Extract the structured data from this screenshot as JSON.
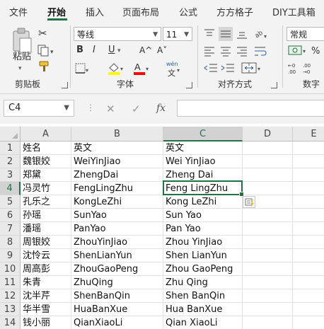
{
  "tabs": [
    "文件",
    "开始",
    "插入",
    "页面布局",
    "公式",
    "方方格子",
    "DIY工具箱"
  ],
  "ribbon": {
    "clipboard": {
      "paste_label": "粘贴",
      "group_label": "剪贴板"
    },
    "font": {
      "name": "等线",
      "size": "11",
      "bold": "B",
      "italic": "I",
      "underline": "U",
      "grow": "A^",
      "shrink": "A˅",
      "group_label": "字体",
      "wen": "wén",
      "wen2": "文"
    },
    "alignment": {
      "group_label": "对齐方式"
    },
    "number": {
      "format": "常规",
      "group_label": "数字"
    }
  },
  "colors": {
    "accent": "#217346",
    "highlight": "#ffff00",
    "font_color": "#ff0000"
  },
  "formula_bar": {
    "name_box": "C4",
    "cancel": "✕",
    "enter": "✓",
    "fx": "fx",
    "value": ""
  },
  "sheet": {
    "columns": [
      "A",
      "B",
      "C",
      "D",
      "E"
    ],
    "selected_column": "C",
    "selected_row": "4",
    "rows": [
      {
        "n": "1",
        "a": "姓名",
        "b": "英文",
        "c": "英文"
      },
      {
        "n": "2",
        "a": "魏银姣",
        "b": "WeiYinJiao",
        "c": "Wei YinJiao"
      },
      {
        "n": "3",
        "a": "郑黛",
        "b": "ZhengDai",
        "c": "Zheng Dai"
      },
      {
        "n": "4",
        "a": "冯灵竹",
        "b": "FengLingZhu",
        "c": "Feng LingZhu"
      },
      {
        "n": "5",
        "a": "孔乐之",
        "b": "KongLeZhi",
        "c": "Kong LeZhi"
      },
      {
        "n": "6",
        "a": "孙瑶",
        "b": "SunYao",
        "c": "Sun Yao"
      },
      {
        "n": "7",
        "a": "潘瑶",
        "b": "PanYao",
        "c": "Pan Yao"
      },
      {
        "n": "8",
        "a": "周银姣",
        "b": "ZhouYinJiao",
        "c": "Zhou YinJiao"
      },
      {
        "n": "9",
        "a": "沈怜云",
        "b": "ShenLianYun",
        "c": "Shen LianYun"
      },
      {
        "n": "10",
        "a": "周高彭",
        "b": "ZhouGaoPeng",
        "c": "Zhou GaoPeng"
      },
      {
        "n": "11",
        "a": "朱青",
        "b": "ZhuQing",
        "c": "Zhu Qing"
      },
      {
        "n": "12",
        "a": "沈半芹",
        "b": "ShenBanQin",
        "c": "Shen BanQin"
      },
      {
        "n": "13",
        "a": "华半雪",
        "b": "HuaBanXue",
        "c": "Hua BanXue"
      },
      {
        "n": "14",
        "a": "钱小丽",
        "b": "QianXiaoLi",
        "c": "Qian XiaoLi"
      }
    ]
  }
}
